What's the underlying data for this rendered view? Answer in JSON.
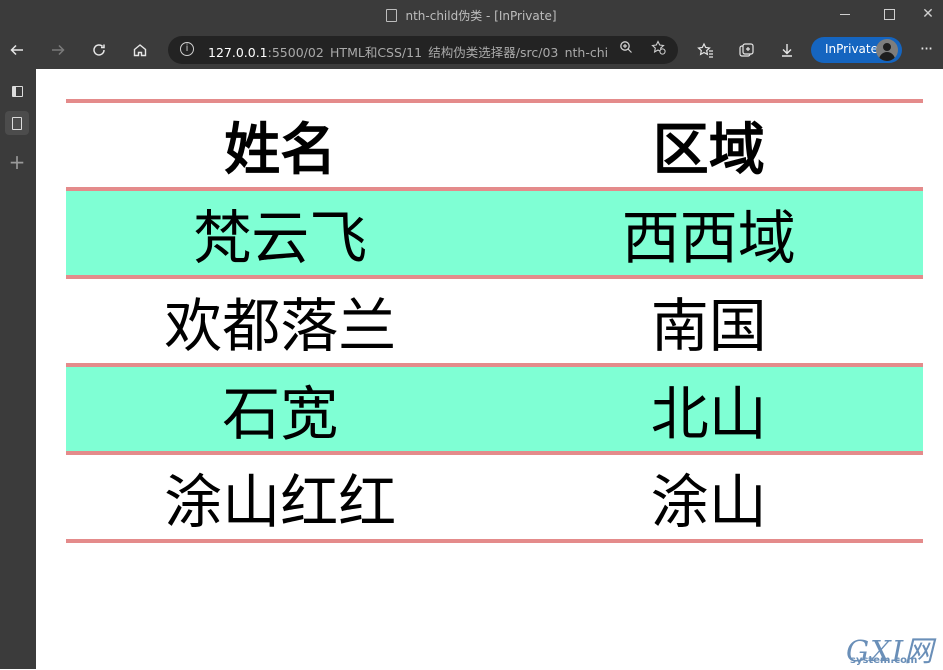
{
  "window": {
    "title": "nth-child伪类 - [InPrivate]"
  },
  "toolbar": {
    "url_host": "127.0.0.1",
    "url_rest": ":5500/02_HTML和CSS/11_结构伪类选择器/src/03_nth-chil...",
    "inprivate_label": "InPrivate",
    "more_label": "···"
  },
  "icons": {
    "back": "arrow-left-icon",
    "forward": "arrow-right-icon",
    "refresh": "refresh-icon",
    "home": "home-icon",
    "info": "info-icon",
    "zoom": "zoom-icon",
    "favorite_add": "star-add-icon",
    "favorites": "favorites-icon",
    "collections": "collections-icon",
    "downloads": "download-icon"
  },
  "table": {
    "headers": [
      "姓名",
      "区域"
    ],
    "rows": [
      [
        "梵云飞",
        "西西域"
      ],
      [
        "欢都落兰",
        "南国"
      ],
      [
        "石宽",
        "北山"
      ],
      [
        "涂山红红",
        "涂山"
      ]
    ]
  },
  "watermark": {
    "letters": "GXI网",
    "site": "system.com"
  },
  "colors": {
    "chrome": "#3b3b3b",
    "row_highlight": "#7fffd4",
    "border": "#e48b8b",
    "inprivate": "#1565c0"
  }
}
